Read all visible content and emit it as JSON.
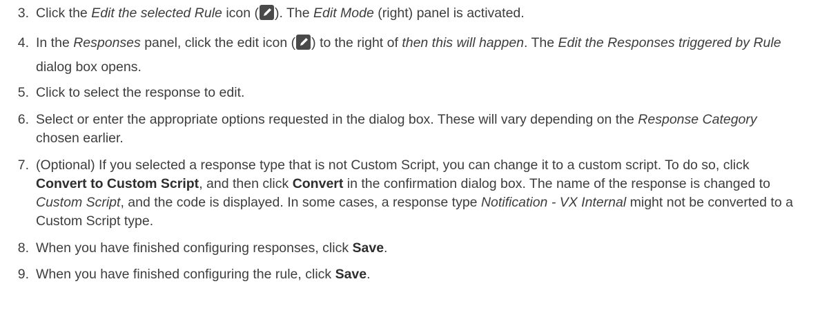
{
  "steps": [
    {
      "num": "3.",
      "parts": [
        {
          "t": "Click the "
        },
        {
          "t": "Edit the selected Rule",
          "s": "em"
        },
        {
          "t": " icon ("
        },
        {
          "icon": "pencil-icon"
        },
        {
          "t": "). The "
        },
        {
          "t": "Edit Mode",
          "s": "em"
        },
        {
          "t": " (right) panel is activated."
        }
      ]
    },
    {
      "num": "4.",
      "parts": [
        {
          "t": "In the "
        },
        {
          "t": "Responses",
          "s": "em"
        },
        {
          "t": " panel, click the edit icon ("
        },
        {
          "icon": "pencil-icon"
        },
        {
          "t": ") to the right of "
        },
        {
          "t": "then this will happen",
          "s": "em"
        },
        {
          "t": ". The "
        },
        {
          "t": "Edit the Responses triggered by Rule",
          "s": "em"
        },
        {
          "t": " dialog box opens."
        }
      ]
    },
    {
      "num": "5.",
      "parts": [
        {
          "t": "Click to select the response to edit."
        }
      ]
    },
    {
      "num": "6.",
      "parts": [
        {
          "t": "Select or enter the appropriate options requested in the dialog box. These will vary depending on the "
        },
        {
          "t": "Response Category",
          "s": "em"
        },
        {
          "t": " chosen earlier."
        }
      ]
    },
    {
      "num": "7.",
      "parts": [
        {
          "t": "(Optional) If you selected a response type that is not Custom Script, you can change it to a custom script. To do so, click "
        },
        {
          "t": "Convert to Custom Script",
          "s": "strong"
        },
        {
          "t": ", and then click "
        },
        {
          "t": "Convert",
          "s": "strong"
        },
        {
          "t": " in the confirmation dialog box. The name of the response is changed to "
        },
        {
          "t": "Custom Script",
          "s": "em"
        },
        {
          "t": ", and the code is displayed. In some cases, a response type "
        },
        {
          "t": "Notification - VX Internal",
          "s": "em"
        },
        {
          "t": " might not be converted to a Custom Script type."
        }
      ]
    },
    {
      "num": "8.",
      "parts": [
        {
          "t": "When you have finished configuring responses, click "
        },
        {
          "t": "Save",
          "s": "strong"
        },
        {
          "t": "."
        }
      ]
    },
    {
      "num": "9.",
      "parts": [
        {
          "t": "When you have finished configuring the rule, click "
        },
        {
          "t": "Save",
          "s": "strong"
        },
        {
          "t": "."
        }
      ]
    }
  ],
  "colors": {
    "text": "#3d3d3d",
    "icon_background": "#4a4a4a",
    "icon_glyph": "#ffffff"
  }
}
